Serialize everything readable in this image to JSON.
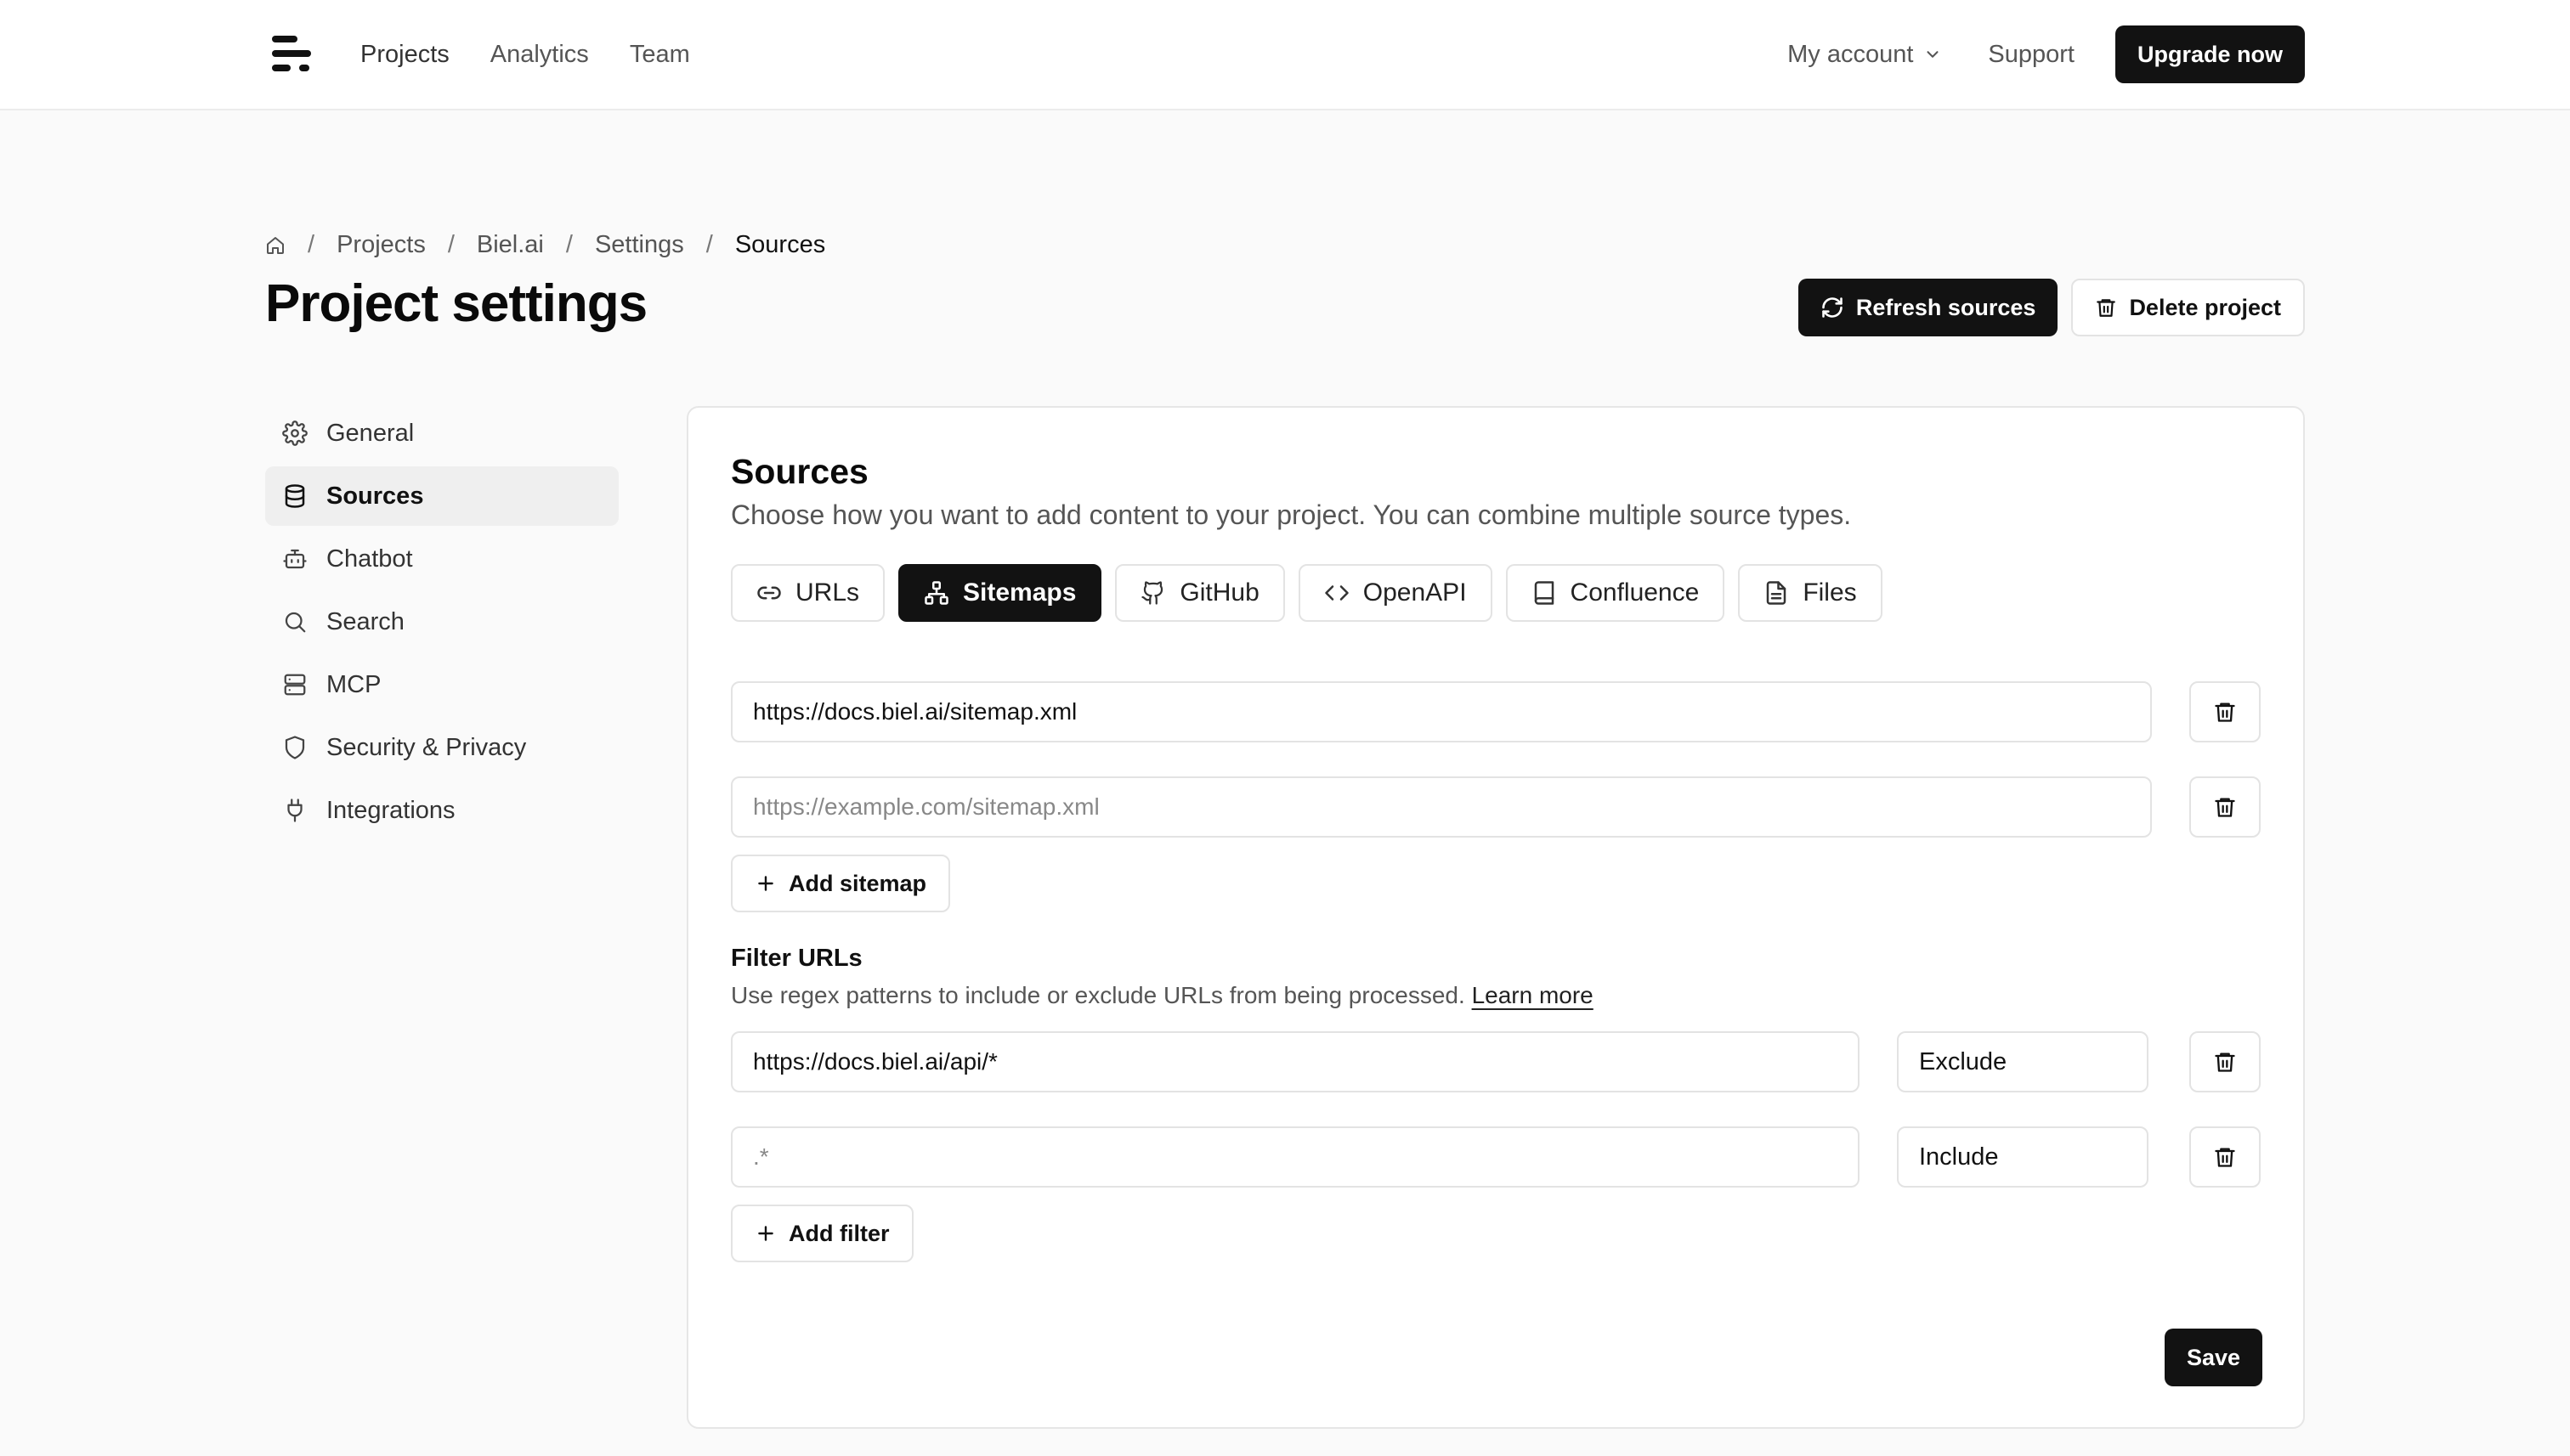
{
  "nav": {
    "logo_icon": "logo-icon",
    "links": [
      "Projects",
      "Analytics",
      "Team"
    ],
    "account_label": "My account",
    "support_label": "Support",
    "upgrade_label": "Upgrade now"
  },
  "breadcrumb": {
    "home_icon": "home-icon",
    "items": [
      "Projects",
      "Biel.ai",
      "Settings",
      "Sources"
    ],
    "separator": "/"
  },
  "page": {
    "title": "Project settings",
    "refresh_label": "Refresh sources",
    "delete_label": "Delete project"
  },
  "sidebar": {
    "items": [
      {
        "label": "General",
        "icon": "gear-icon"
      },
      {
        "label": "Sources",
        "icon": "database-icon",
        "active": true
      },
      {
        "label": "Chatbot",
        "icon": "bot-icon"
      },
      {
        "label": "Search",
        "icon": "search-icon"
      },
      {
        "label": "MCP",
        "icon": "server-icon"
      },
      {
        "label": "Security & Privacy",
        "icon": "shield-icon"
      },
      {
        "label": "Integrations",
        "icon": "plug-icon"
      }
    ]
  },
  "sources": {
    "title": "Sources",
    "description": "Choose how you want to add content to your project. You can combine multiple source types.",
    "tabs": [
      {
        "label": "URLs",
        "icon": "link-icon"
      },
      {
        "label": "Sitemaps",
        "icon": "sitemap-icon",
        "active": true
      },
      {
        "label": "GitHub",
        "icon": "github-icon"
      },
      {
        "label": "OpenAPI",
        "icon": "code-icon"
      },
      {
        "label": "Confluence",
        "icon": "book-icon"
      },
      {
        "label": "Files",
        "icon": "file-icon"
      }
    ],
    "sitemaps": [
      {
        "value": "https://docs.biel.ai/sitemap.xml",
        "placeholder": "https://example.com/sitemap.xml"
      },
      {
        "value": "",
        "placeholder": "https://example.com/sitemap.xml"
      }
    ],
    "add_sitemap_label": "Add sitemap",
    "filter": {
      "title": "Filter URLs",
      "description": "Use regex patterns to include or exclude URLs from being processed.",
      "learn_more": "Learn more",
      "rows": [
        {
          "value": "https://docs.biel.ai/api/*",
          "placeholder": ".*",
          "mode": "Exclude"
        },
        {
          "value": "",
          "placeholder": ".*",
          "mode": "Include"
        }
      ],
      "add_filter_label": "Add filter"
    },
    "save_label": "Save"
  }
}
